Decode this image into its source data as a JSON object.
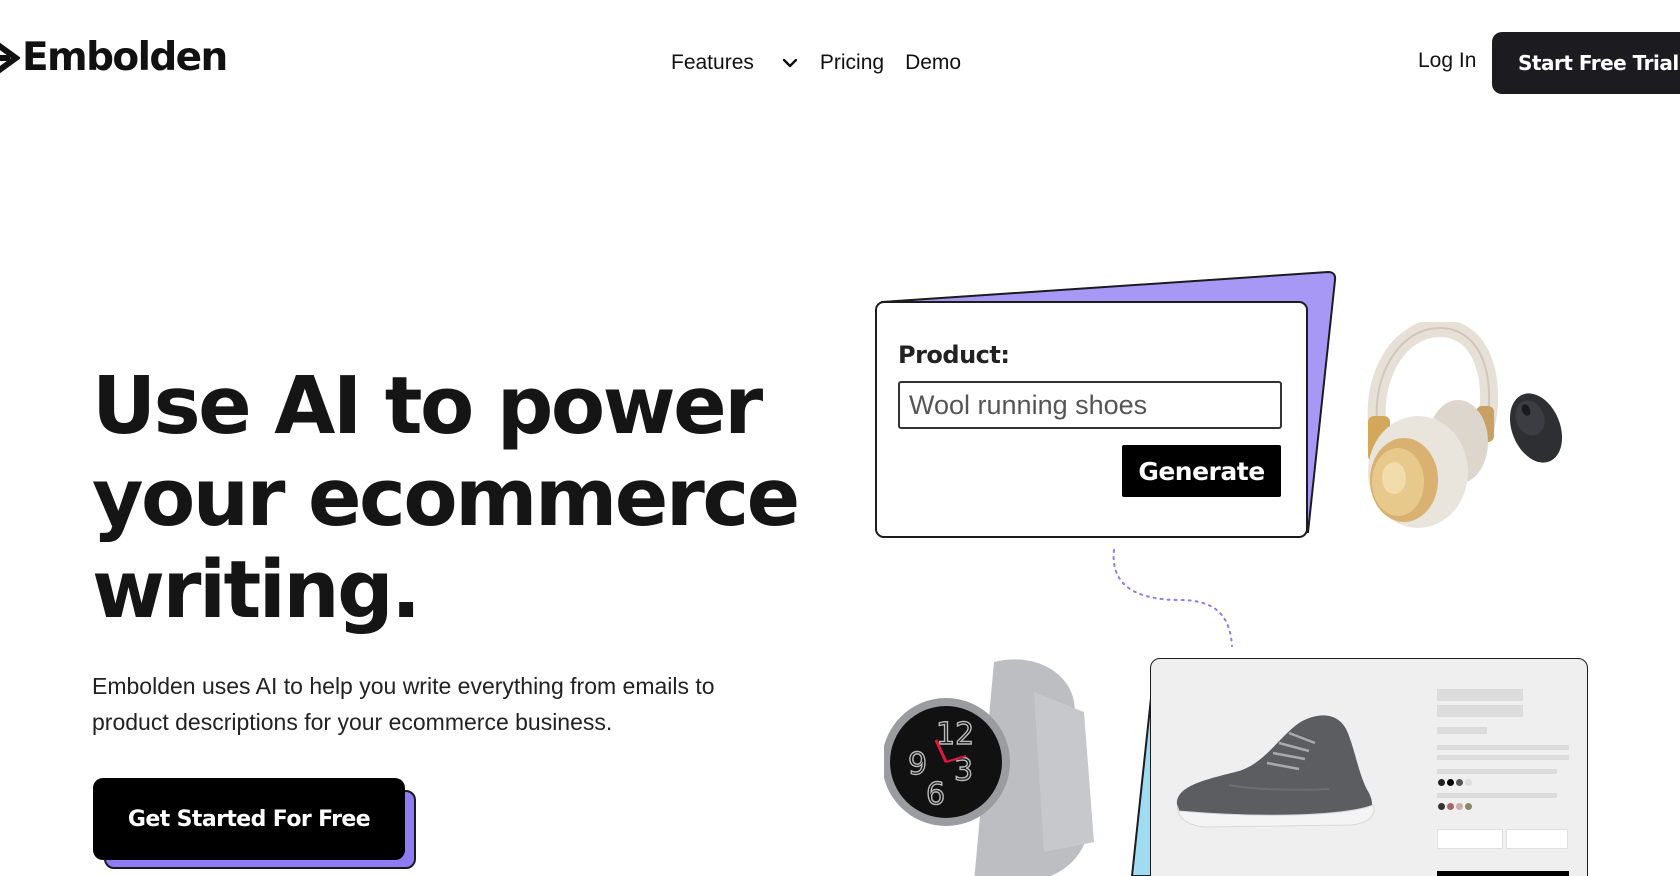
{
  "header": {
    "logo_text": "Embolden",
    "nav": {
      "features_label": "Features",
      "pricing_label": "Pricing",
      "demo_label": "Demo"
    },
    "login_label": "Log In",
    "trial_button_label": "Start Free Trial"
  },
  "hero": {
    "title_line1": "Use AI to power",
    "title_line2": "your ecommerce",
    "title_line3": "writing.",
    "subtitle_line1": "Embolden uses AI to help you write everything from emails to",
    "subtitle_line2": "product descriptions for your ecommerce business.",
    "cta_label": "Get Started For Free"
  },
  "illustration": {
    "product_label": "Product:",
    "product_input_value": "Wool running shoes",
    "generate_label": "Generate"
  },
  "colors": {
    "accent_purple": "#a898f5",
    "cta_shadow_purple": "#8f7cf2",
    "accent_cyan": "#9fdcf2",
    "dark": "#1b1b20"
  },
  "icons": {
    "logo": "embolden-logo-icon",
    "features_toggle": "chevron-down-icon"
  }
}
